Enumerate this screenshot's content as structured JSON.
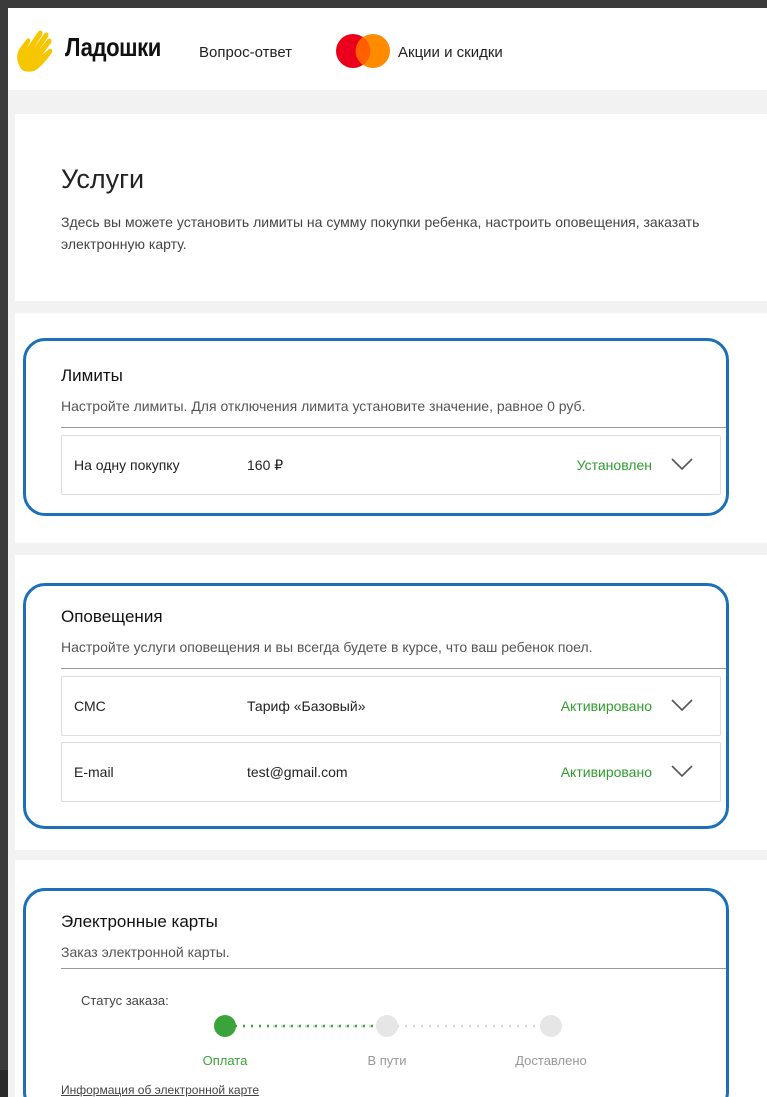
{
  "header": {
    "logo_text": "Ладошки",
    "nav": [
      {
        "label": "Вопрос-ответ"
      },
      {
        "label": "Акции и скидки"
      }
    ],
    "colors": {
      "logo_yellow": "#f6c600",
      "mc_red": "#eb001b",
      "mc_orange": "#ff8c00"
    }
  },
  "intro": {
    "title": "Услуги",
    "description": "Здесь вы можете установить лимиты на сумму покупки ребенка, настроить оповещения, заказать электронную карту."
  },
  "limits": {
    "title": "Лимиты",
    "description": "Настройте лимиты. Для отключения лимита установите значение, равное 0 руб.",
    "rows": [
      {
        "label": "На одну покупку",
        "value": "160 ₽",
        "status": "Установлен"
      }
    ]
  },
  "notifications": {
    "title": "Оповещения",
    "description": "Настройте услуги оповещения и вы всегда будете в курсе, что ваш ребенок поел.",
    "rows": [
      {
        "label": "СМС",
        "value": "Тариф «Базовый»",
        "status": "Активировано"
      },
      {
        "label": "E-mail",
        "value": "test@gmail.com",
        "status": "Активировано"
      }
    ]
  },
  "ecards": {
    "title": "Электронные карты",
    "description": "Заказ электронной карты.",
    "status_label": "Статус заказа:",
    "steps": [
      {
        "label": "Оплата",
        "done": true
      },
      {
        "label": "В пути",
        "done": false
      },
      {
        "label": "Доставлено",
        "done": false
      }
    ],
    "link": "Информация об электронной карте"
  },
  "colors": {
    "accent_green": "#2f9e2f",
    "highlight_blue": "#1d6fb8",
    "step_inactive": "#e6e6e6"
  }
}
